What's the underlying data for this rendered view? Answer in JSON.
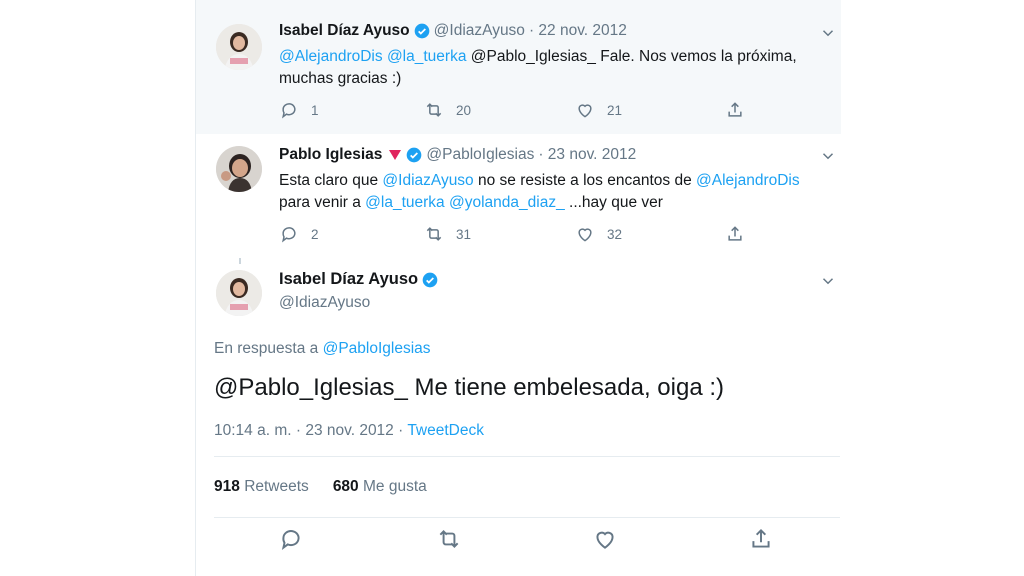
{
  "tweets": [
    {
      "name": "Isabel Díaz Ayuso",
      "handle": "@IdiazAyuso",
      "date": "· 22 nov. 2012",
      "text_parts": {
        "m1": "@AlejandroDis",
        "m2": "@la_tuerka",
        "rest1": "@Pablo_Iglesias_ Fale. Nos vemos la próxima,",
        "line2": "muchas gracias :)"
      },
      "replies": "1",
      "retweets": "20",
      "likes": "21"
    },
    {
      "name": "Pablo Iglesias",
      "handle": "@PabloIglesias",
      "date": "· 23 nov. 2012",
      "text_parts": {
        "t1": "Esta claro que",
        "m1": "@IdiazAyuso",
        "t2": "no se resiste a los encantos de",
        "m2": "@AlejandroDis",
        "t3": "para venir a",
        "m3": "@la_tuerka",
        "m4": "@yolanda_diaz_",
        "t4": "...hay que ver"
      },
      "replies": "2",
      "retweets": "31",
      "likes": "32"
    }
  ],
  "main": {
    "name": "Isabel Díaz Ayuso",
    "handle": "@IdiazAyuso",
    "reply_prefix": "En respuesta a",
    "reply_handle": "@PabloIglesias",
    "text": "@Pablo_Iglesias_  Me tiene embelesada, oiga :)",
    "time": "10:14 a. m. · 23 nov. 2012 ·",
    "source": "TweetDeck",
    "retweets_count": "918",
    "retweets_label": "Retweets",
    "likes_count": "680",
    "likes_label": "Me gusta"
  },
  "icons": {
    "reply": "reply-icon",
    "retweet": "retweet-icon",
    "like": "heart-icon",
    "share": "share-icon",
    "verified": "verified-badge-icon",
    "more": "chevron-down-icon"
  },
  "colors": {
    "accent": "#1da1f2",
    "muted": "#657786",
    "highlight_bg": "#f5f8fa"
  }
}
